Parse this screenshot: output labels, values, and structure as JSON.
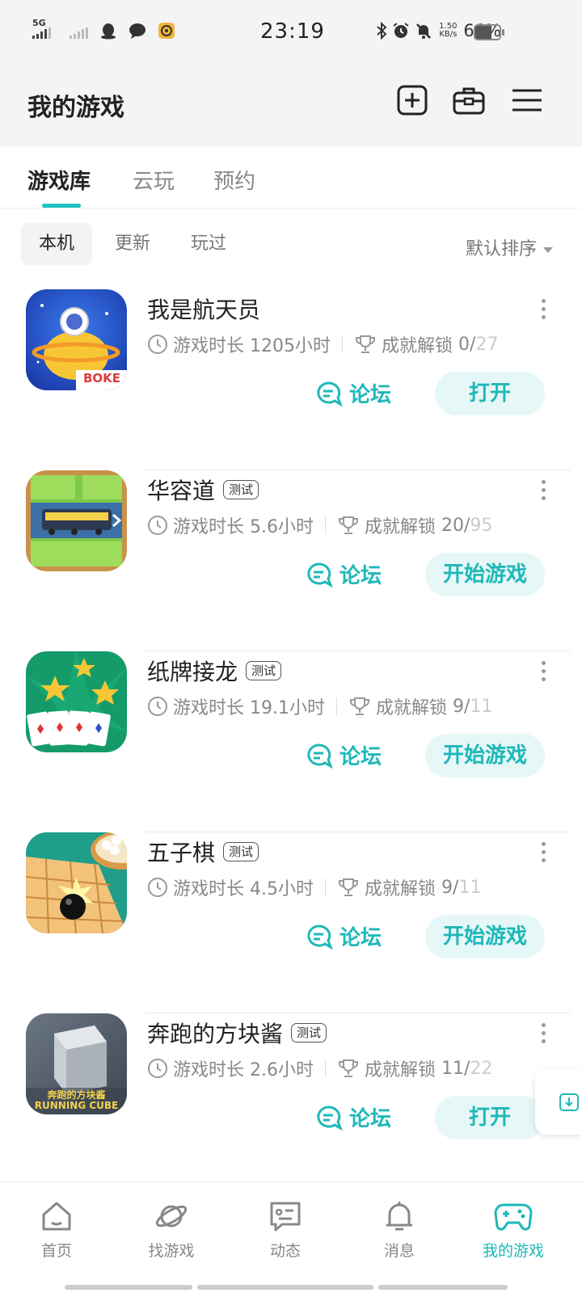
{
  "status_bar": {
    "network": "5G",
    "time": "23:19",
    "speed_value": "1.50",
    "speed_unit": "KB/s",
    "battery": "66%",
    "battery_level": 0.66
  },
  "header": {
    "title": "我的游戏",
    "icons": [
      "add-square-icon",
      "toolbox-icon",
      "menu-icon"
    ]
  },
  "tabs": [
    {
      "label": "游戏库",
      "active": true
    },
    {
      "label": "云玩",
      "active": false
    },
    {
      "label": "预约",
      "active": false
    }
  ],
  "filters": [
    {
      "label": "本机",
      "active": true
    },
    {
      "label": "更新",
      "active": false
    },
    {
      "label": "玩过",
      "active": false
    }
  ],
  "sort_label": "默认排序",
  "games": [
    {
      "name": "我是航天员",
      "badge": "",
      "playtime_label": "游戏时长",
      "playtime": "1205小时",
      "achievement_label": "成就解锁",
      "achieved": "0/",
      "achievement_total": "27",
      "forum_label": "论坛",
      "action_label": "打开",
      "icon_text": "BOKE"
    },
    {
      "name": "华容道",
      "badge": "测试",
      "playtime_label": "游戏时长",
      "playtime": "5.6小时",
      "achievement_label": "成就解锁",
      "achieved": "20/",
      "achievement_total": "95",
      "forum_label": "论坛",
      "action_label": "开始游戏",
      "icon_text": ""
    },
    {
      "name": "纸牌接龙",
      "badge": "测试",
      "playtime_label": "游戏时长",
      "playtime": "19.1小时",
      "achievement_label": "成就解锁",
      "achieved": "9/",
      "achievement_total": "11",
      "forum_label": "论坛",
      "action_label": "开始游戏",
      "icon_text": ""
    },
    {
      "name": "五子棋",
      "badge": "测试",
      "playtime_label": "游戏时长",
      "playtime": "4.5小时",
      "achievement_label": "成就解锁",
      "achieved": "9/",
      "achievement_total": "11",
      "forum_label": "论坛",
      "action_label": "开始游戏",
      "icon_text": ""
    },
    {
      "name": "奔跑的方块酱",
      "badge": "测试",
      "playtime_label": "游戏时长",
      "playtime": "2.6小时",
      "achievement_label": "成就解锁",
      "achieved": "11/",
      "achievement_total": "22",
      "forum_label": "论坛",
      "action_label": "打开",
      "icon_text": "奔跑的方块酱 RUNNING CUBE"
    }
  ],
  "bottom_nav": [
    {
      "label": "首页",
      "icon": "home-icon",
      "active": false
    },
    {
      "label": "找游戏",
      "icon": "planet-icon",
      "active": false
    },
    {
      "label": "动态",
      "icon": "chat-icon",
      "active": false
    },
    {
      "label": "消息",
      "icon": "bell-icon",
      "active": false
    },
    {
      "label": "我的游戏",
      "icon": "gamepad-icon",
      "active": true
    }
  ],
  "colors": {
    "accent": "#1fb8b8",
    "action_bg": "#e6f7f8",
    "header_bg": "#f3f4f6"
  }
}
